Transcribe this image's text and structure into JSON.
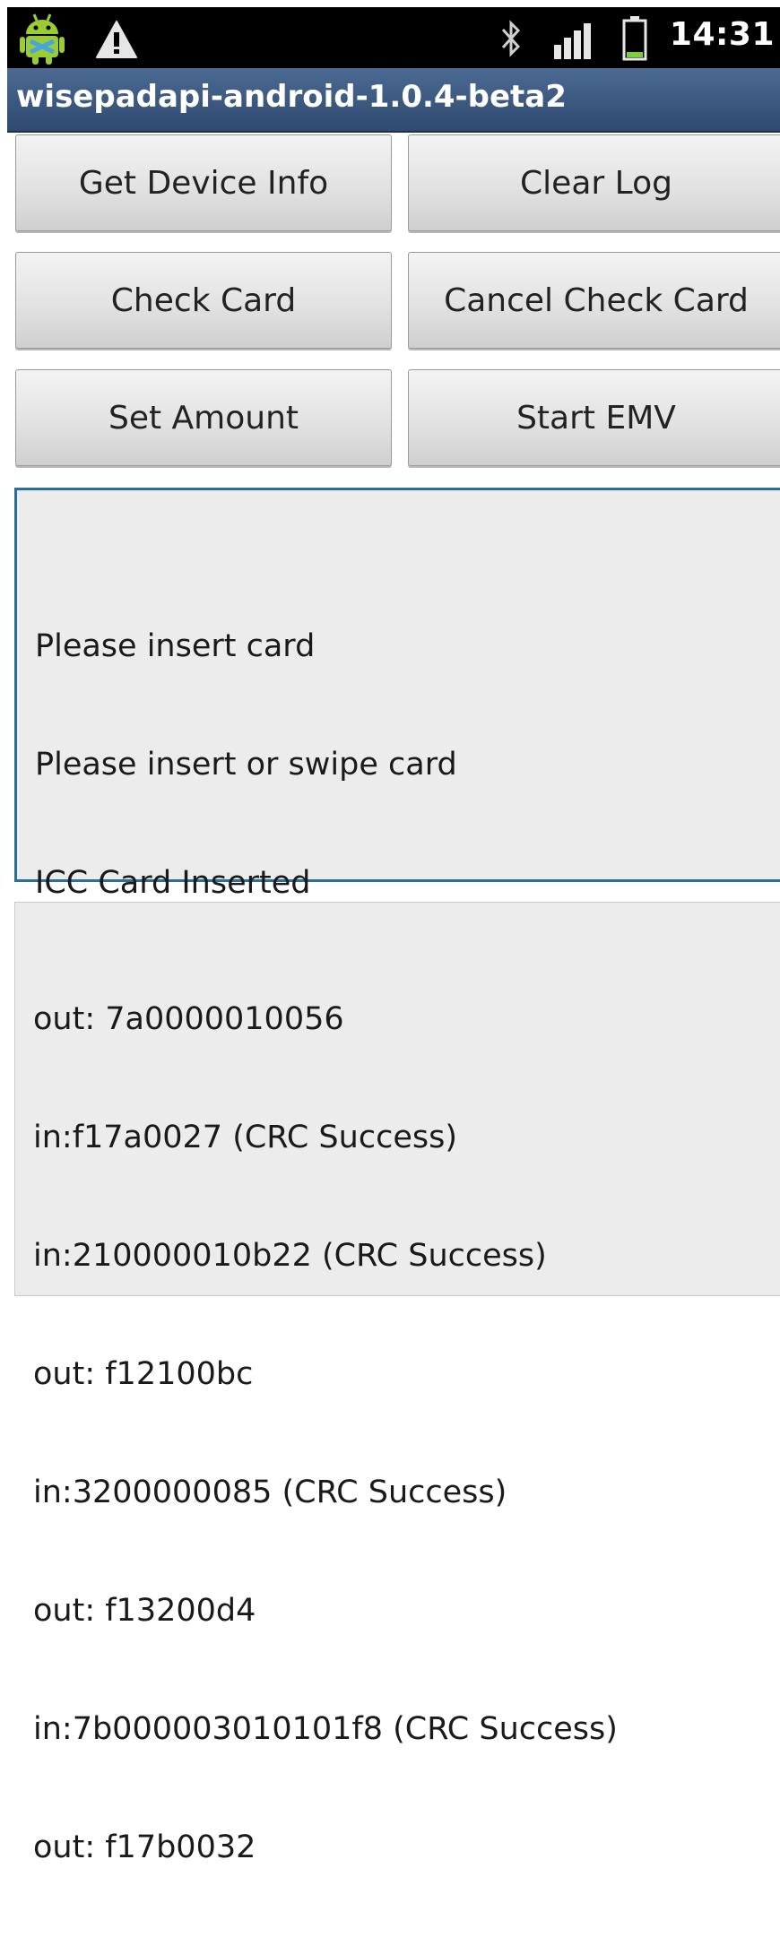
{
  "status_bar": {
    "time": "14:31",
    "icons": [
      "android-debug-icon",
      "warning-icon",
      "bluetooth-icon",
      "signal-icon",
      "battery-icon"
    ]
  },
  "app": {
    "title": "wisepadapi-android-1.0.4-beta2"
  },
  "buttons": {
    "get_device_info": "Get Device Info",
    "clear_log": "Clear Log",
    "check_card": "Check Card",
    "cancel_check_card": "Cancel Check Card",
    "set_amount": "Set Amount",
    "start_emv": "Start EMV"
  },
  "status_log": {
    "lines": [
      "Please insert card",
      "Please insert or swipe card",
      "ICC Card Inserted"
    ]
  },
  "comm_log": {
    "lines": [
      "out: 7a0000010056",
      "in:f17a0027 (CRC Success)",
      "in:210000010b22 (CRC Success)",
      "out: f12100bc",
      "in:3200000085 (CRC Success)",
      "out: f13200d4",
      "in:7b000003010101f8 (CRC Success)",
      "out: f17b0032"
    ]
  },
  "colors": {
    "status_bar_bg": "#000000",
    "title_bar_bg": "#3b5a82",
    "focus_border": "#2b6f98",
    "log_bg": "#ececec"
  }
}
